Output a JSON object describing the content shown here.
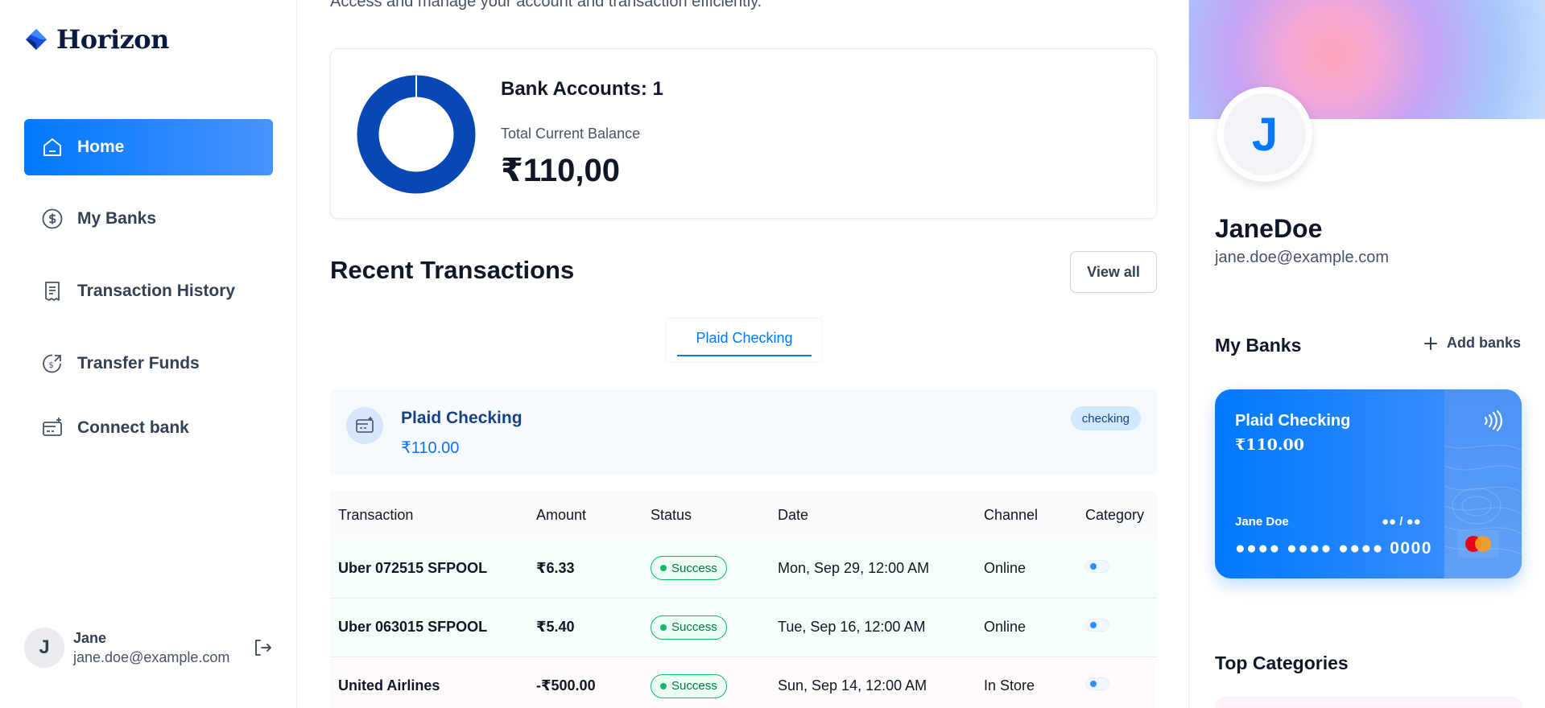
{
  "app": {
    "name": "Horizon"
  },
  "sidebar": {
    "items": [
      {
        "label": "Home",
        "icon": "home-icon",
        "active": true
      },
      {
        "label": "My Banks",
        "icon": "dollar-circle-icon",
        "active": false
      },
      {
        "label": "Transaction History",
        "icon": "receipt-icon",
        "active": false
      },
      {
        "label": "Transfer Funds",
        "icon": "money-send-icon",
        "active": false
      },
      {
        "label": "Connect bank",
        "icon": "card-add-icon",
        "active": false
      }
    ],
    "footer": {
      "initial": "J",
      "name": "Jane",
      "email": "jane.doe@example.com",
      "logout_icon": "logout-icon"
    }
  },
  "main": {
    "subheader": "Access and manage your account and transaction efficiently.",
    "balance": {
      "accounts_label": "Bank Accounts: 1",
      "total_label": "Total Current Balance",
      "total_value": "₹110,00",
      "donut_color": "#0747b6"
    },
    "recent": {
      "title": "Recent Transactions",
      "view_all": "View all",
      "tabs": [
        {
          "label": "Plaid Checking",
          "active": true
        }
      ],
      "bank_info": {
        "name": "Plaid Checking",
        "amount": "₹110.00",
        "badge": "checking"
      },
      "table": {
        "columns": [
          "Transaction",
          "Amount",
          "Status",
          "Date",
          "Channel",
          "Category"
        ],
        "rows": [
          {
            "name": "Uber 072515 SFPOOL",
            "amount": "₹6.33",
            "type": "credit",
            "status": "Success",
            "date": "Mon, Sep 29, 12:00 AM",
            "channel": "Online"
          },
          {
            "name": "Uber 063015 SFPOOL",
            "amount": "₹5.40",
            "type": "credit",
            "status": "Success",
            "date": "Tue, Sep 16, 12:00 AM",
            "channel": "Online"
          },
          {
            "name": "United Airlines",
            "amount": "-₹500.00",
            "type": "debit",
            "status": "Success",
            "date": "Sun, Sep 14, 12:00 AM",
            "channel": "In Store"
          }
        ]
      }
    }
  },
  "right": {
    "profile": {
      "initial": "J",
      "name": "JaneDoe",
      "email": "jane.doe@example.com"
    },
    "my_banks": {
      "title": "My Banks",
      "add_label": "Add banks",
      "card": {
        "bank_name": "Plaid Checking",
        "balance": "₹110.00",
        "holder": "Jane Doe",
        "expiry": "●● / ●●",
        "number": "●●●● ●●●● ●●●● 0000",
        "network_icon": "mastercard-icon"
      }
    },
    "top_categories": {
      "title": "Top Categories"
    }
  },
  "colors": {
    "primary": "#0179fe",
    "credit": "#039855",
    "debit": "#f04438",
    "success_border": "#12b76a"
  }
}
